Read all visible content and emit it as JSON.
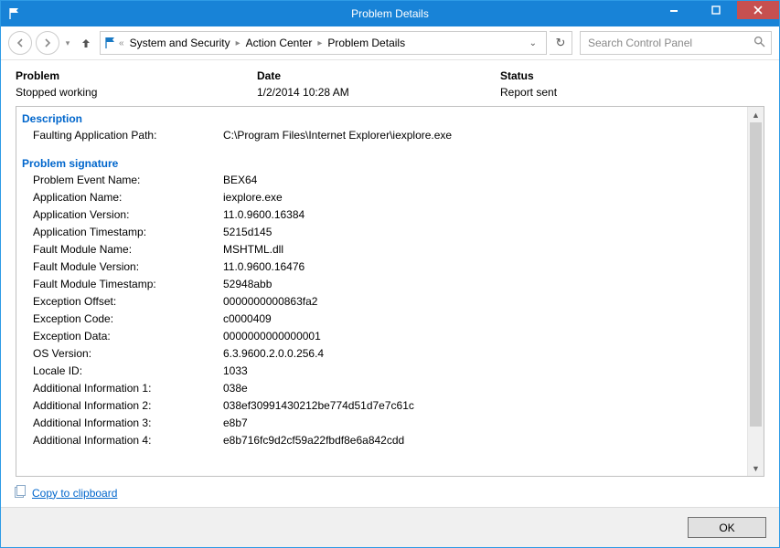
{
  "window_title": "Problem Details",
  "breadcrumb": {
    "seg1": "System and Security",
    "seg2": "Action Center",
    "seg3": "Problem Details"
  },
  "search_placeholder": "Search Control Panel",
  "summary": {
    "head1": "Problem",
    "val1": "Stopped working",
    "head2": "Date",
    "val2": "1/2/2014 10:28 AM",
    "head3": "Status",
    "val3": "Report sent"
  },
  "sections": {
    "description_title": "Description",
    "description": {
      "k1": "Faulting Application Path:",
      "v1": "C:\\Program Files\\Internet Explorer\\iexplore.exe"
    },
    "signature_title": "Problem signature",
    "signature": {
      "k1": "Problem Event Name:",
      "v1": "BEX64",
      "k2": "Application Name:",
      "v2": "iexplore.exe",
      "k3": "Application Version:",
      "v3": "11.0.9600.16384",
      "k4": "Application Timestamp:",
      "v4": "5215d145",
      "k5": "Fault Module Name:",
      "v5": "MSHTML.dll",
      "k6": "Fault Module Version:",
      "v6": "11.0.9600.16476",
      "k7": "Fault Module Timestamp:",
      "v7": "52948abb",
      "k8": "Exception Offset:",
      "v8": "0000000000863fa2",
      "k9": "Exception Code:",
      "v9": "c0000409",
      "k10": "Exception Data:",
      "v10": "0000000000000001",
      "k11": "OS Version:",
      "v11": "6.3.9600.2.0.0.256.4",
      "k12": "Locale ID:",
      "v12": "1033",
      "k13": "Additional Information 1:",
      "v13": "038e",
      "k14": "Additional Information 2:",
      "v14": "038ef30991430212be774d51d7e7c61c",
      "k15": "Additional Information 3:",
      "v15": "e8b7",
      "k16": "Additional Information 4:",
      "v16": "e8b716fc9d2cf59a22fbdf8e6a842cdd"
    }
  },
  "copy_label": "Copy to clipboard",
  "ok_label": "OK"
}
